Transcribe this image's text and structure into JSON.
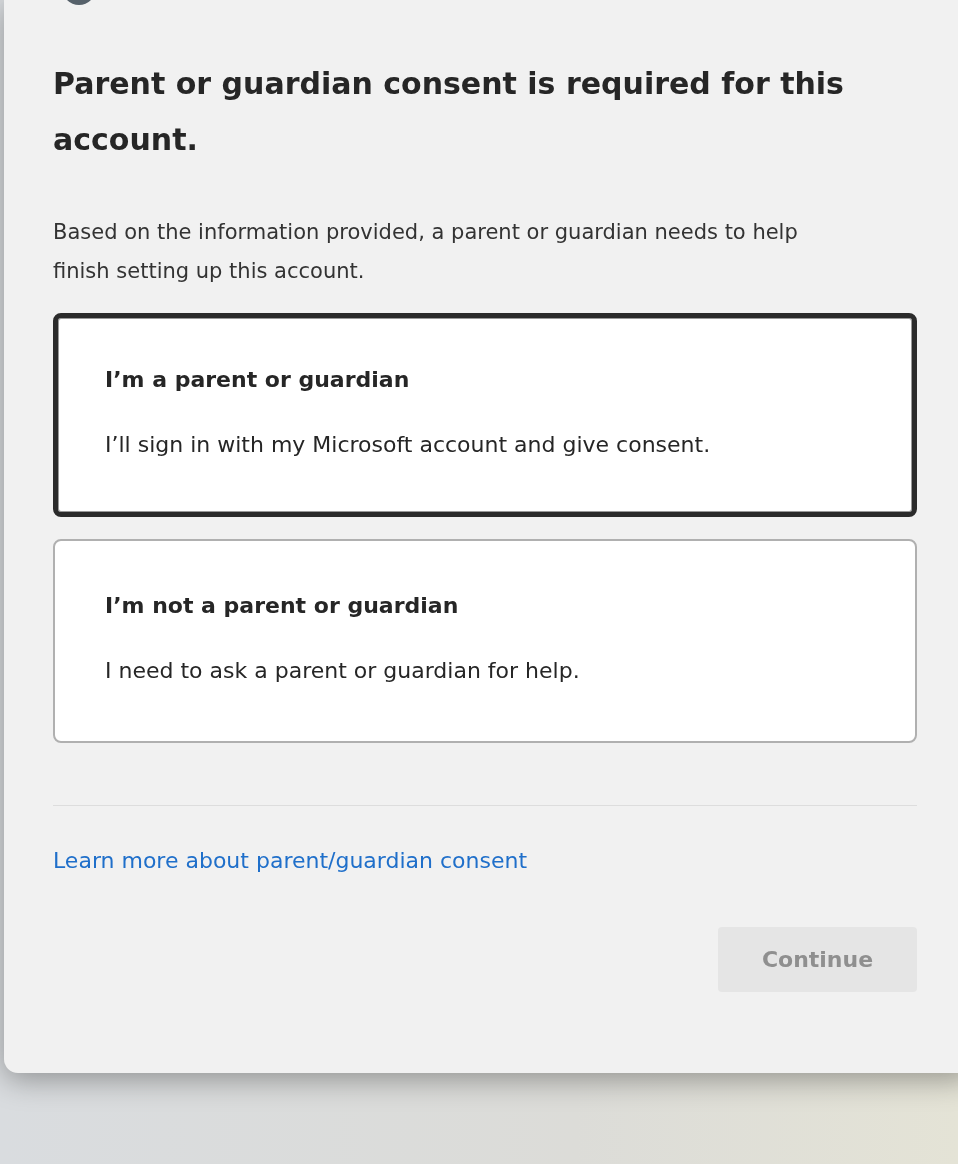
{
  "dialog": {
    "title": "Parent or guardian consent is required for this account.",
    "description": "Based on the information provided, a parent or guardian needs to help finish setting up this account.",
    "options": [
      {
        "title": "I’m a parent or guardian",
        "description": "I’ll sign in with my Microsoft account and give consent.",
        "selected": true
      },
      {
        "title": "I’m not a parent or guardian",
        "description": "I need to ask a parent or guardian for help.",
        "selected": false
      }
    ],
    "link": "Learn more about parent/guardian consent",
    "continue_button": {
      "label": "Continue",
      "disabled": true
    }
  }
}
